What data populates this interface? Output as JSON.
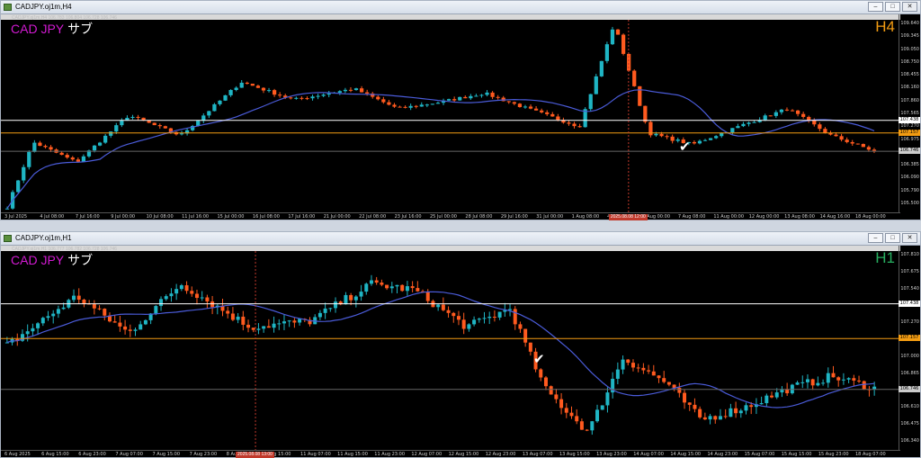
{
  "windows": {
    "h4": {
      "title": "CADJPY.oj1m,H4",
      "ohlc_line": "CADJPY.oj1m,H4  106.783 106.804 106.728 106.746",
      "symbol": "CAD JPY",
      "subtitle": "サブ",
      "timeframe": "H4",
      "timeframe_color": "#f39c12",
      "price_ticks": [
        "109.640",
        "109.345",
        "109.050",
        "108.750",
        "108.455",
        "108.160",
        "107.860",
        "107.565",
        "107.270",
        "106.975",
        "106.680",
        "106.385",
        "106.090",
        "105.790",
        "105.500"
      ],
      "price_marks": {
        "white_line": "107.438",
        "orange_line": "107.157",
        "current": "106.746",
        "white_line_color": "#ffffff",
        "orange_line_color": "#f39c12",
        "current_color": "#cccccc"
      },
      "time_ticks": [
        "3 Jul 2025",
        "4 Jul 08:00",
        "7 Jul 16:00",
        "9 Jul 00:00",
        "10 Jul 08:00",
        "11 Jul 16:00",
        "15 Jul 00:00",
        "16 Jul 08:00",
        "17 Jul 16:00",
        "21 Jul 00:00",
        "22 Jul 08:00",
        "23 Jul 16:00",
        "25 Jul 00:00",
        "28 Jul 08:00",
        "29 Jul 16:00",
        "31 Jul 00:00",
        "1 Aug 08:00",
        "4 Aug 16:00",
        "6 Aug 00:00",
        "7 Aug 08:00",
        "11 Aug 00:00",
        "12 Aug 00:00",
        "13 Aug 08:00",
        "14 Aug 16:00",
        "18 Aug 00:00"
      ],
      "time_highlight": "2025.08.08 12:00"
    },
    "h1": {
      "title": "CADJPY.oj1m,H1",
      "ohlc_line": "CADJPY.oj1m,H1  106.777 106.782 106.728 106.746",
      "symbol": "CAD JPY",
      "subtitle": "サブ",
      "timeframe": "H1",
      "timeframe_color": "#27ae60",
      "price_ticks": [
        "107.810",
        "107.675",
        "107.540",
        "107.405",
        "107.270",
        "107.135",
        "107.000",
        "106.865",
        "106.745",
        "106.610",
        "106.475",
        "106.340"
      ],
      "price_marks": {
        "white_line": "107.438",
        "orange_line": "107.157",
        "current": "106.746",
        "white_line_color": "#ffffff",
        "orange_line_color": "#f39c12",
        "current_color": "#cccccc"
      },
      "time_ticks": [
        "6 Aug 2025",
        "6 Aug 15:00",
        "6 Aug 23:00",
        "7 Aug 07:00",
        "7 Aug 15:00",
        "7 Aug 23:00",
        "8 Aug 07:00",
        "8 Aug 15:00",
        "11 Aug 07:00",
        "11 Aug 15:00",
        "11 Aug 23:00",
        "12 Aug 07:00",
        "12 Aug 15:00",
        "12 Aug 23:00",
        "13 Aug 07:00",
        "13 Aug 15:00",
        "13 Aug 23:00",
        "14 Aug 07:00",
        "14 Aug 15:00",
        "14 Aug 23:00",
        "15 Aug 07:00",
        "15 Aug 15:00",
        "15 Aug 23:00",
        "18 Aug 07:00"
      ],
      "time_highlight": "2025.08.08 13:00"
    }
  },
  "colors": {
    "bull": "#1fb5c4",
    "bear": "#ff5a1f",
    "ma": "#4a5bd8",
    "background": "#000000"
  }
}
